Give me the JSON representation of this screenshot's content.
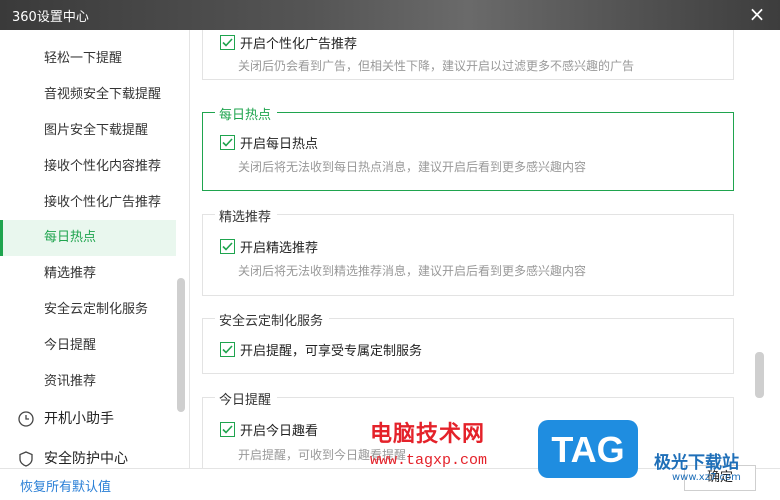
{
  "window": {
    "title": "360设置中心",
    "close_glyph": "×"
  },
  "sidebar": {
    "items": [
      {
        "label": "轻松一下提醒",
        "active": false
      },
      {
        "label": "音视频安全下载提醒",
        "active": false
      },
      {
        "label": "图片安全下载提醒",
        "active": false
      },
      {
        "label": "接收个性化内容推荐",
        "active": false
      },
      {
        "label": "接收个性化广告推荐",
        "active": false
      },
      {
        "label": "每日热点",
        "active": true
      },
      {
        "label": "精选推荐",
        "active": false
      },
      {
        "label": "安全云定制化服务",
        "active": false
      },
      {
        "label": "今日提醒",
        "active": false
      },
      {
        "label": "资讯推荐",
        "active": false
      }
    ],
    "groups": [
      {
        "label": "开机小助手",
        "icon": "clock-icon"
      },
      {
        "label": "安全防护中心",
        "icon": "shield-icon"
      }
    ]
  },
  "sections": [
    {
      "title": "",
      "checkbox_label": "开启个性化广告推荐",
      "checked": true,
      "desc": "关闭后仍会看到广告，但相关性下降，建议开启以过滤更多不感兴趣的广告"
    },
    {
      "title": "每日热点",
      "checkbox_label": "开启每日热点",
      "checked": true,
      "desc": "关闭后将无法收到每日热点消息，建议开启后看到更多感兴趣内容"
    },
    {
      "title": "精选推荐",
      "checkbox_label": "开启精选推荐",
      "checked": true,
      "desc": "关闭后将无法收到精选推荐消息，建议开启后看到更多感兴趣内容"
    },
    {
      "title": "安全云定制化服务",
      "checkbox_label": "开启提醒，可享受专属定制服务",
      "checked": true,
      "desc": ""
    },
    {
      "title": "今日提醒",
      "checkbox_label": "开启今日趣看",
      "checked": true,
      "desc": "开启提醒，可收到今日趣看提醒"
    }
  ],
  "footer": {
    "restore_label": "恢复所有默认值",
    "ok_label": "确定"
  },
  "watermark": {
    "text": "电脑技术网",
    "url": "www.tagxp.com",
    "logo_text": "TAG",
    "site_name": "极光下载站",
    "site_url": "www.xz7.com"
  },
  "colors": {
    "accent": "#1fa44e",
    "link": "#2a7fd6",
    "watermark_red": "#e4222a",
    "logo_blue": "#1f8de0"
  }
}
